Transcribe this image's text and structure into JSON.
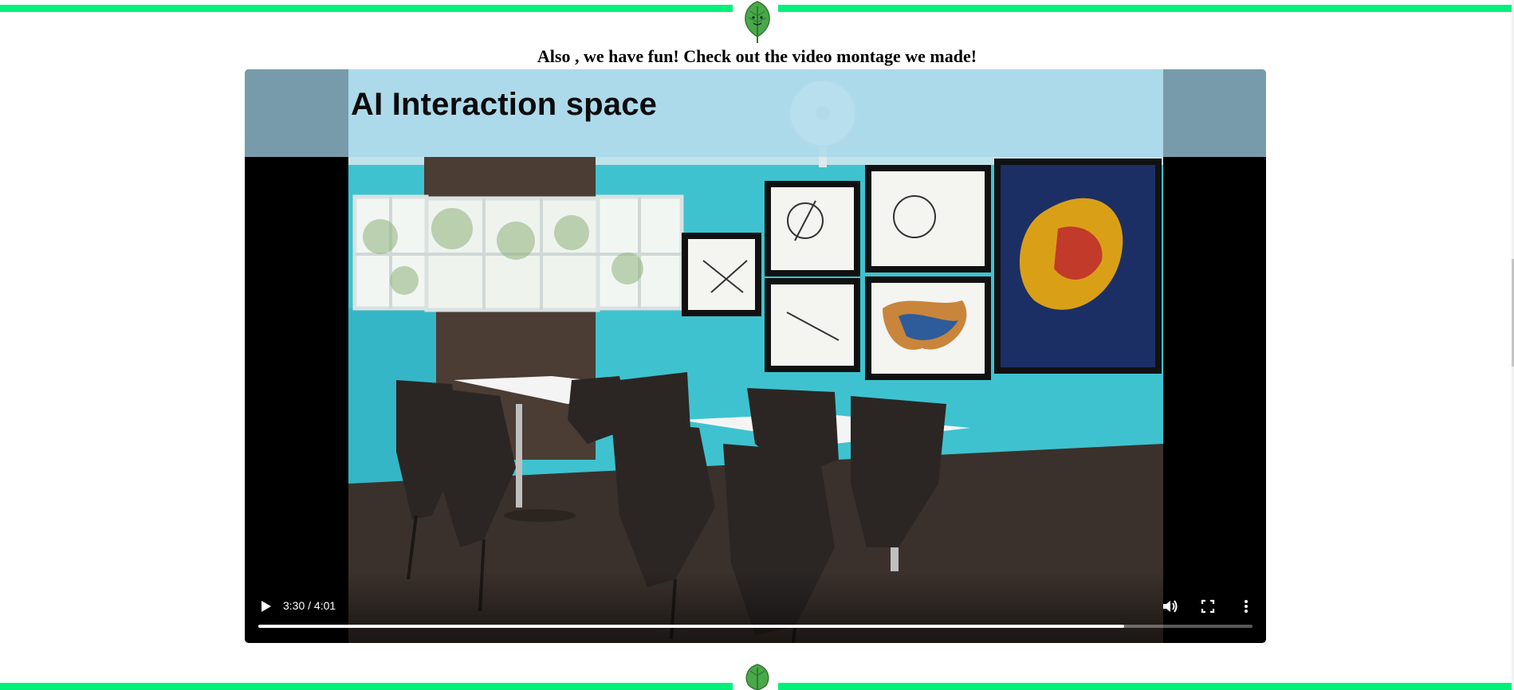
{
  "section": {
    "heading": "Also , we have fun! Check out the video montage we made!"
  },
  "video": {
    "overlay_title": "AI Interaction space",
    "time_display": "3:30 / 4:01",
    "progress_fraction": 0.871,
    "controls": {
      "play_icon": "play-icon",
      "volume_icon": "volume-icon",
      "fullscreen_icon": "fullscreen-icon",
      "more_icon": "more-options-icon"
    }
  },
  "colors": {
    "accent_green": "#00f07a",
    "leaf_green": "#4aa84a",
    "wall_teal": "#3fc2cf"
  }
}
